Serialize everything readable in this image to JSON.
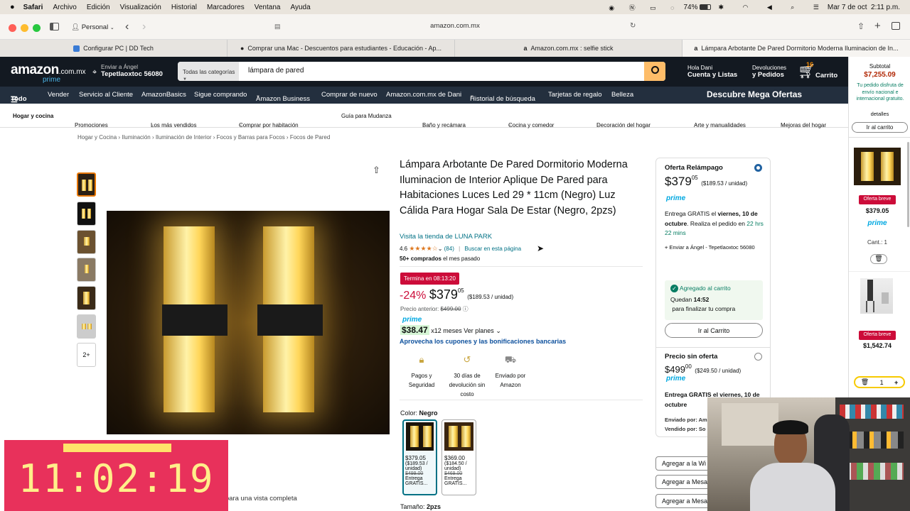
{
  "macbar": {
    "app": "Safari",
    "menus": [
      "Archivo",
      "Edición",
      "Visualización",
      "Historial",
      "Marcadores",
      "Ventana",
      "Ayuda"
    ],
    "battery": "74%",
    "datetime": "Mar 7 de oct  2:11 p.m."
  },
  "browser": {
    "profile": "Personal",
    "address": "amazon.com.mx",
    "tabs": [
      "Configurar PC | DD Tech",
      "Comprar una Mac - Descuentos para estudiantes - Educación - Ap...",
      "Amazon.com.mx : selfie stick",
      "Lámpara Arbotante De Pared Dormitorio Moderna Iluminacion de In..."
    ]
  },
  "header": {
    "logo": "amazon",
    "logo_domain": ".com.mx",
    "logo_prime": "prime",
    "deliver_label": "Enviar a Ángel",
    "deliver_location": "Tepetlaoxtoc 56080",
    "search_category": "Todas las categorías",
    "search_value": "lámpara de pared",
    "account_greeting": "Hola Dani",
    "account_label": "Cuenta y Listas",
    "returns_line1": "Devoluciones",
    "returns_line2": "y Pedidos",
    "cart_count": "16",
    "cart_label": "Carrito"
  },
  "nav": {
    "all": "Todo",
    "items": [
      "Vender",
      "Servicio al Cliente",
      "AmazonBasics",
      "Sigue comprando",
      "Amazon Business",
      "Comprar de nuevo",
      "Amazon.com.mx de Dani",
      "Historial de búsqueda",
      "Tarjetas de regalo",
      "Belleza"
    ],
    "promo": "Descubre Mega Ofertas"
  },
  "catnav": [
    "Hogar y cocina",
    "Promociones",
    "Los más vendidos",
    "Comprar por habitación",
    "Guía para Mudanza",
    "Baño y recámara",
    "Cocina y comedor",
    "Decoración del hogar",
    "Arte y manualidades",
    "Mejoras del hogar"
  ],
  "breadcrumb": [
    "Hogar y Cocina",
    "Iluminación",
    "Iluminación de Interior",
    "Focos y Barras para Focos",
    "Focos de Pared"
  ],
  "gallery": {
    "more": "2+",
    "caption": "Haz clic para una vista completa"
  },
  "product": {
    "title": "Lámpara Arbotante De Pared Dormitorio Moderna Iluminacion de Interior Aplique De Pared para Habitaciones Luces Led 29 * 11cm (Negro) Luz Cálida Para Hogar Sala De Estar (Negro, 2pzs)",
    "store": "Visita la tienda de LUNA PARK",
    "rating": "4.6",
    "stars": "★★★★☆",
    "reviews": "(84)",
    "search_page": "Buscar en esta página",
    "bought_bold": "50+ comprados",
    "bought_rest": " el mes pasado",
    "deal_timer": "Termina en 08:13:20",
    "discount": "-24%",
    "price_whole": "$379",
    "price_cents": "05",
    "unit_price": "($189.53 / unidad)",
    "prev_label": "Precio anterior: ",
    "prev_price": "$499.00",
    "prime": "prime",
    "installment": "$38.47",
    "installment_term": "x12 meses",
    "plans": "Ver planes",
    "coupons": "Aprovecha los cupones y las bonificaciones bancarias",
    "features": [
      {
        "icon": "lock-icon",
        "label": "Pagos y Seguridad"
      },
      {
        "icon": "return-icon",
        "label": "30 días de devolución sin costo"
      },
      {
        "icon": "truck-icon",
        "label": "Enviado por Amazon"
      }
    ],
    "color_label": "Color: ",
    "color_value": "Negro",
    "variants": [
      {
        "price": "$379.05",
        "unit": "($189.53 / unidad)",
        "old": "$499.00",
        "delivery": "Entrega GRATIS..."
      },
      {
        "price": "$369.00",
        "unit": "($184.50 / unidad)",
        "old": "$469.00",
        "delivery": "Entrega GRATIS..."
      }
    ],
    "size_label": "Tamaño: ",
    "size_value": "2pzs"
  },
  "buybox": {
    "deal_label": "Oferta Relámpago",
    "price_whole": "$379",
    "price_cents": "05",
    "unit_price": "($189.53 / unidad)",
    "prime": "prime",
    "delivery_pre": "Entrega GRATIS el ",
    "delivery_date": "viernes, 10 de octubre",
    "delivery_mid": ". Realiza el pedido en ",
    "delivery_time": "22 hrs 22 mins",
    "ship_to": "Enviar a Ángel - Tepetlaoxtoc 56080",
    "added": "Agregado al carrito",
    "remaining_pre": "Quedan ",
    "remaining_time": "14:52",
    "remaining_post": " para finalizar tu compra",
    "goto_cart": "Ir al Carrito",
    "no_deal_label": "Precio sin oferta",
    "no_deal_whole": "$499",
    "no_deal_cents": "00",
    "no_deal_unit": "($249.50 / unidad)",
    "no_deal_delivery": "Entrega GRATIS el viernes, 10 de octubre",
    "sent_by": "Enviado por: Am",
    "sold_by": "Vendido por: So",
    "wishlist": "Agregar a la Wi",
    "registry1": "Agregar a Mesa",
    "registry2": "Agregar a Mesa"
  },
  "sidecart": {
    "subtotal_label": "Subtotal",
    "subtotal": "$7,255.09",
    "free_ship": "Tu pedido disfruta de envío nacional e internacional gratuito.",
    "details": "detalles",
    "goto_cart": "Ir al carrito",
    "items": [
      {
        "badge": "Oferta breve",
        "price": "$379.05",
        "qty_label": "Cant.: 1"
      },
      {
        "badge": "Oferta breve",
        "price": "$1,542.74",
        "qty": "1"
      }
    ]
  },
  "overlay": {
    "timer": "11:02:19"
  },
  "colors": {
    "amazon_dark": "#131921",
    "amazon_nav": "#232f3e",
    "search_button": "#febd69",
    "deal_red": "#cc0c39",
    "link": "#007185",
    "prime_blue": "#00a8e1",
    "timer_pink": "#e8315b",
    "timer_bg": "#ffe36a"
  }
}
